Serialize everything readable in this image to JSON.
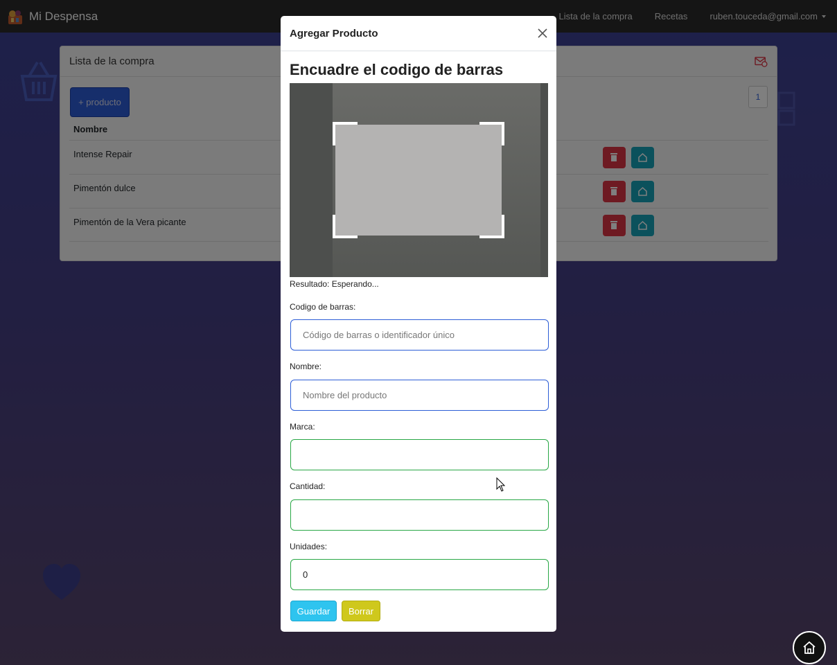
{
  "navbar": {
    "brand": "Mi Despensa",
    "links": [
      "Lista de la compra",
      "Recetas"
    ],
    "user": "ruben.touceda@gmail.com"
  },
  "background_card": {
    "title": "Lista de la compra",
    "add_button": "+ producto",
    "pager": "1",
    "column_header": "Nombre",
    "rows": [
      "Intense Repair",
      "Pimentón dulce",
      "Pimentón de la Vera picante"
    ]
  },
  "modal": {
    "title": "Agregar Producto",
    "scan_title": "Encuadre el codigo de barras",
    "result": "Resultado: Esperando...",
    "fields": {
      "barcode": {
        "label": "Codigo de barras:",
        "value": "",
        "placeholder": "Código de barras o identificador único"
      },
      "name": {
        "label": "Nombre:",
        "value": "",
        "placeholder": "Nombre del producto"
      },
      "brand": {
        "label": "Marca:",
        "value": ""
      },
      "quantity": {
        "label": "Cantidad:",
        "value": ""
      },
      "units": {
        "label": "Unidades:",
        "value": "0"
      }
    },
    "save_button": "Guardar",
    "clear_button": "Borrar"
  },
  "colors": {
    "primary": "#2c5dd6",
    "danger": "#dc3545",
    "info": "#17a2b8",
    "success_border": "#28a745",
    "save": "#2ec4ef",
    "clear": "#cfc81c"
  }
}
